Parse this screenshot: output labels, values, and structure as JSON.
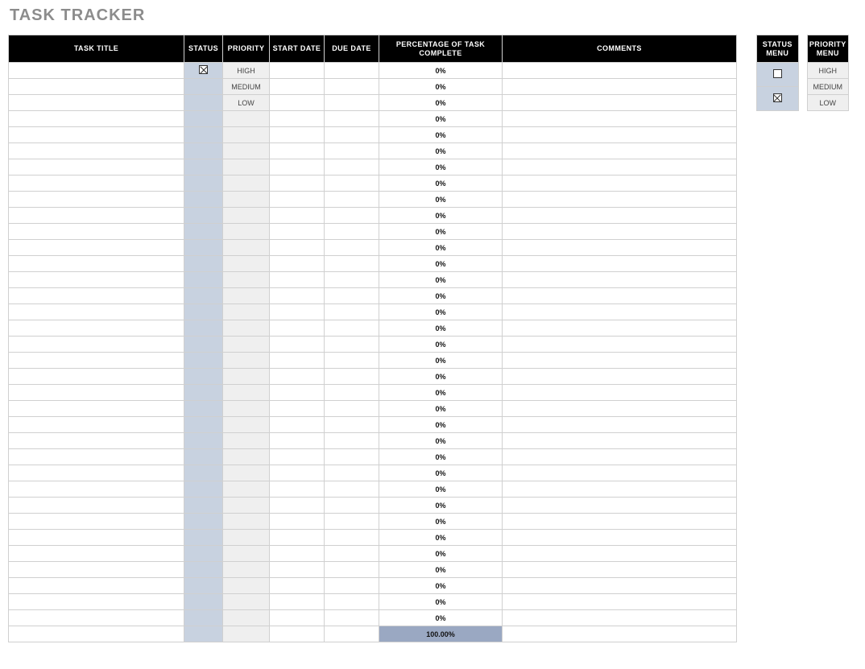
{
  "title": "TASK TRACKER",
  "headers": {
    "task_title": "TASK TITLE",
    "status": "STATUS",
    "priority": "PRIORITY",
    "start_date": "START DATE",
    "due_date": "DUE DATE",
    "pct": "PERCENTAGE OF TASK COMPLETE",
    "comments": "COMMENTS"
  },
  "rows": [
    {
      "title": "",
      "status": "checked",
      "priority": "HIGH",
      "start": "",
      "due": "",
      "pct": "0%",
      "comments": ""
    },
    {
      "title": "",
      "status": "",
      "priority": "MEDIUM",
      "start": "",
      "due": "",
      "pct": "0%",
      "comments": ""
    },
    {
      "title": "",
      "status": "",
      "priority": "LOW",
      "start": "",
      "due": "",
      "pct": "0%",
      "comments": ""
    },
    {
      "title": "",
      "status": "",
      "priority": "",
      "start": "",
      "due": "",
      "pct": "0%",
      "comments": ""
    },
    {
      "title": "",
      "status": "",
      "priority": "",
      "start": "",
      "due": "",
      "pct": "0%",
      "comments": ""
    },
    {
      "title": "",
      "status": "",
      "priority": "",
      "start": "",
      "due": "",
      "pct": "0%",
      "comments": ""
    },
    {
      "title": "",
      "status": "",
      "priority": "",
      "start": "",
      "due": "",
      "pct": "0%",
      "comments": ""
    },
    {
      "title": "",
      "status": "",
      "priority": "",
      "start": "",
      "due": "",
      "pct": "0%",
      "comments": ""
    },
    {
      "title": "",
      "status": "",
      "priority": "",
      "start": "",
      "due": "",
      "pct": "0%",
      "comments": ""
    },
    {
      "title": "",
      "status": "",
      "priority": "",
      "start": "",
      "due": "",
      "pct": "0%",
      "comments": ""
    },
    {
      "title": "",
      "status": "",
      "priority": "",
      "start": "",
      "due": "",
      "pct": "0%",
      "comments": ""
    },
    {
      "title": "",
      "status": "",
      "priority": "",
      "start": "",
      "due": "",
      "pct": "0%",
      "comments": ""
    },
    {
      "title": "",
      "status": "",
      "priority": "",
      "start": "",
      "due": "",
      "pct": "0%",
      "comments": ""
    },
    {
      "title": "",
      "status": "",
      "priority": "",
      "start": "",
      "due": "",
      "pct": "0%",
      "comments": ""
    },
    {
      "title": "",
      "status": "",
      "priority": "",
      "start": "",
      "due": "",
      "pct": "0%",
      "comments": ""
    },
    {
      "title": "",
      "status": "",
      "priority": "",
      "start": "",
      "due": "",
      "pct": "0%",
      "comments": ""
    },
    {
      "title": "",
      "status": "",
      "priority": "",
      "start": "",
      "due": "",
      "pct": "0%",
      "comments": ""
    },
    {
      "title": "",
      "status": "",
      "priority": "",
      "start": "",
      "due": "",
      "pct": "0%",
      "comments": ""
    },
    {
      "title": "",
      "status": "",
      "priority": "",
      "start": "",
      "due": "",
      "pct": "0%",
      "comments": ""
    },
    {
      "title": "",
      "status": "",
      "priority": "",
      "start": "",
      "due": "",
      "pct": "0%",
      "comments": ""
    },
    {
      "title": "",
      "status": "",
      "priority": "",
      "start": "",
      "due": "",
      "pct": "0%",
      "comments": ""
    },
    {
      "title": "",
      "status": "",
      "priority": "",
      "start": "",
      "due": "",
      "pct": "0%",
      "comments": ""
    },
    {
      "title": "",
      "status": "",
      "priority": "",
      "start": "",
      "due": "",
      "pct": "0%",
      "comments": ""
    },
    {
      "title": "",
      "status": "",
      "priority": "",
      "start": "",
      "due": "",
      "pct": "0%",
      "comments": ""
    },
    {
      "title": "",
      "status": "",
      "priority": "",
      "start": "",
      "due": "",
      "pct": "0%",
      "comments": ""
    },
    {
      "title": "",
      "status": "",
      "priority": "",
      "start": "",
      "due": "",
      "pct": "0%",
      "comments": ""
    },
    {
      "title": "",
      "status": "",
      "priority": "",
      "start": "",
      "due": "",
      "pct": "0%",
      "comments": ""
    },
    {
      "title": "",
      "status": "",
      "priority": "",
      "start": "",
      "due": "",
      "pct": "0%",
      "comments": ""
    },
    {
      "title": "",
      "status": "",
      "priority": "",
      "start": "",
      "due": "",
      "pct": "0%",
      "comments": ""
    },
    {
      "title": "",
      "status": "",
      "priority": "",
      "start": "",
      "due": "",
      "pct": "0%",
      "comments": ""
    },
    {
      "title": "",
      "status": "",
      "priority": "",
      "start": "",
      "due": "",
      "pct": "0%",
      "comments": ""
    },
    {
      "title": "",
      "status": "",
      "priority": "",
      "start": "",
      "due": "",
      "pct": "0%",
      "comments": ""
    },
    {
      "title": "",
      "status": "",
      "priority": "",
      "start": "",
      "due": "",
      "pct": "0%",
      "comments": ""
    },
    {
      "title": "",
      "status": "",
      "priority": "",
      "start": "",
      "due": "",
      "pct": "0%",
      "comments": ""
    },
    {
      "title": "",
      "status": "",
      "priority": "",
      "start": "",
      "due": "",
      "pct": "0%",
      "comments": ""
    }
  ],
  "total": {
    "pct": "100.00%"
  },
  "status_menu": {
    "header": "STATUS MENU",
    "items": [
      "unchecked",
      "checked"
    ]
  },
  "priority_menu": {
    "header": "PRIORITY MENU",
    "items": [
      "HIGH",
      "MEDIUM",
      "LOW"
    ]
  }
}
